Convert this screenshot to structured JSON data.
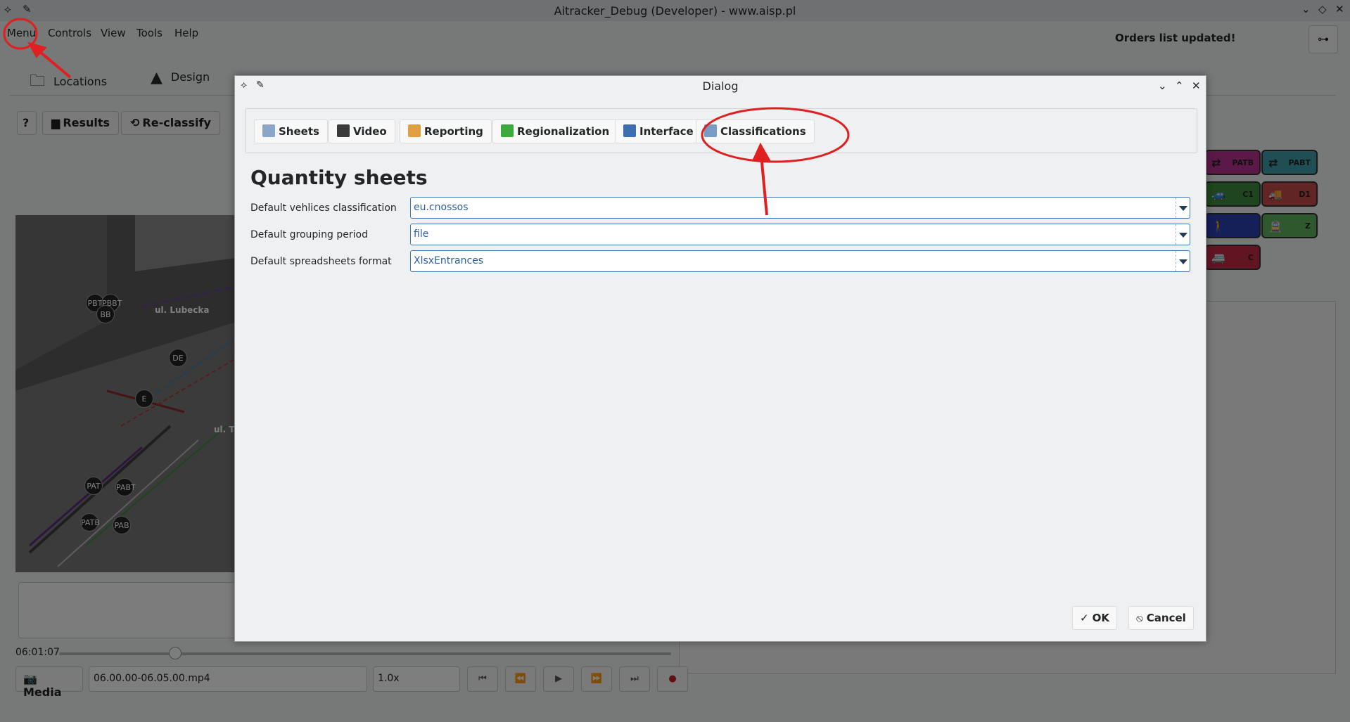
{
  "window": {
    "title": "Aitracker_Debug (Developer) - www.aisp.pl"
  },
  "menubar": {
    "items": [
      "Menu",
      "Controls",
      "View",
      "Tools",
      "Help"
    ]
  },
  "status_message": "Orders list updated!",
  "page_tabs": [
    "Locations",
    "Design"
  ],
  "results_toolbar": {
    "results_label": "Results",
    "reclassify_label": "Re-classify",
    "help_label": "?"
  },
  "video": {
    "street_labels": [
      "ul. Lubecka",
      "ul. Ta"
    ],
    "nodes": [
      "PBT",
      "PBBT",
      "BB",
      "DE",
      "E",
      "PAT",
      "PABT",
      "PATB",
      "PAB"
    ]
  },
  "player": {
    "time": "06:01:07",
    "progress": 0.19,
    "media_label": "Media",
    "file": "06.00.00-06.05.00.mp4",
    "speed": "1.0x"
  },
  "class_tiles": [
    {
      "label": "PATB",
      "color": "#b8338e"
    },
    {
      "label": "PABT",
      "color": "#3f9fa8"
    },
    {
      "label": "C1",
      "color": "#3c8a3c"
    },
    {
      "label": "D1",
      "color": "#c44b4b"
    },
    {
      "label": "",
      "color": "#2b3fb0"
    },
    {
      "label": "Z",
      "color": "#5cb05c"
    },
    {
      "label": "C",
      "color": "#c22b46"
    }
  ],
  "dialog": {
    "title": "Dialog",
    "tabs": [
      {
        "label": "Sheets",
        "icon": "sheet-icon",
        "color": "#8aa7c9"
      },
      {
        "label": "Video",
        "icon": "clapperboard-icon",
        "color": "#3a3a3a"
      },
      {
        "label": "Reporting",
        "icon": "report-icon",
        "color": "#e0a040"
      },
      {
        "label": "Regionalization",
        "icon": "map-icon",
        "color": "#3caa3c"
      },
      {
        "label": "Interface",
        "icon": "interface-icon",
        "color": "#3d6fb0"
      },
      {
        "label": "Classifications",
        "icon": "classification-icon",
        "color": "#7a9cc4"
      }
    ],
    "section_title": "Quantity sheets",
    "fields": [
      {
        "label": "Default vehlices classification",
        "value": "eu.cnossos"
      },
      {
        "label": "Default grouping period",
        "value": "file"
      },
      {
        "label": "Default spreadsheets format",
        "value": "XlsxEntrances"
      }
    ],
    "ok_label": "OK",
    "cancel_label": "Cancel"
  },
  "annotations": {
    "color": "#e02020"
  }
}
